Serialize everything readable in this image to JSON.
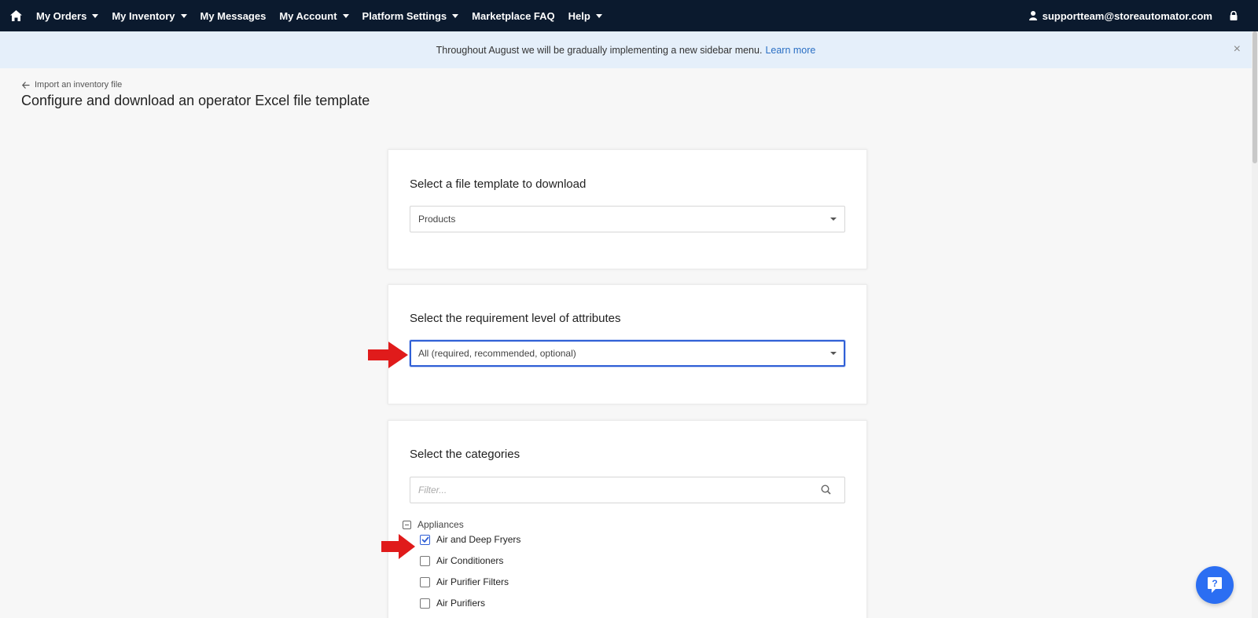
{
  "navbar": {
    "items": [
      {
        "label": "My Orders",
        "dropdown": true
      },
      {
        "label": "My Inventory",
        "dropdown": true
      },
      {
        "label": "My Messages",
        "dropdown": false
      },
      {
        "label": "My Account",
        "dropdown": true
      },
      {
        "label": "Platform Settings",
        "dropdown": true
      },
      {
        "label": "Marketplace FAQ",
        "dropdown": false
      },
      {
        "label": "Help",
        "dropdown": true
      }
    ],
    "user_email": "supportteam@storeautomator.com",
    "icons": [
      "home-icon",
      "user-icon",
      "lock-icon"
    ]
  },
  "announcement": {
    "text": "Throughout August we will be gradually implementing a new sidebar menu.",
    "link_label": "Learn more",
    "close_label": "×"
  },
  "header": {
    "back_label": "Import an inventory file",
    "title": "Configure and download an operator Excel file template"
  },
  "file_template": {
    "title": "Select a file template to download",
    "selected": "Products"
  },
  "requirement_level": {
    "title": "Select the requirement level of attributes",
    "selected": "All (required, recommended, optional)"
  },
  "categories": {
    "title": "Select the categories",
    "filter_placeholder": "Filter...",
    "group_label": "Appliances",
    "items": [
      {
        "label": "Air and Deep Fryers",
        "checked": true
      },
      {
        "label": "Air Conditioners",
        "checked": false
      },
      {
        "label": "Air Purifier Filters",
        "checked": false
      },
      {
        "label": "Air Purifiers",
        "checked": false
      }
    ]
  },
  "colors": {
    "navbar_bg": "#0b1a2e",
    "announcement_bg": "#e5effa",
    "accent": "#2f5fd6",
    "annotation_arrow": "#e01b1b",
    "help_button": "#2b6ef2"
  }
}
